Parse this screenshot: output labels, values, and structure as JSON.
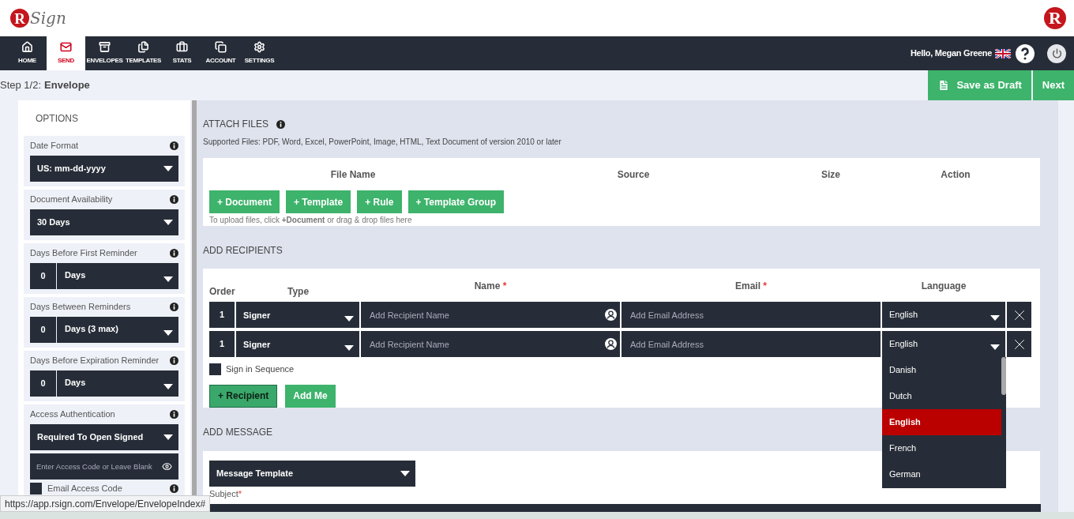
{
  "header": {
    "logo": {
      "mark": "R",
      "word": "Sign"
    },
    "corner_logo": "R"
  },
  "nav": {
    "tabs": [
      {
        "label": "HOME",
        "selected": false
      },
      {
        "label": "SEND",
        "selected": true
      },
      {
        "label": "ENVELOPES",
        "selected": false
      },
      {
        "label": "TEMPLATES",
        "selected": false
      },
      {
        "label": "STATS",
        "selected": false
      },
      {
        "label": "ACCOUNT",
        "selected": false
      },
      {
        "label": "SETTINGS",
        "selected": false
      }
    ],
    "greeting": "Hello, Megan Greene"
  },
  "step": {
    "label": "Step 1/2:",
    "title": "Envelope"
  },
  "actions": [
    {
      "label": "Save as Draft",
      "kind": "draft"
    },
    {
      "label": "Next",
      "kind": "plain"
    }
  ],
  "options": {
    "title": "OPTIONS",
    "fields": [
      {
        "label": "Date Format",
        "kind": "select",
        "value": "US: mm-dd-yyyy"
      },
      {
        "label": "Document Availability",
        "kind": "select",
        "value": "30 Days"
      },
      {
        "label": "Days Before First Reminder",
        "kind": "count",
        "count": "0",
        "value": "Days"
      },
      {
        "label": "Days Between Reminders",
        "kind": "count",
        "count": "0",
        "value": "Days (3 max)"
      },
      {
        "label": "Days Before Expiration Reminder",
        "kind": "count",
        "count": "0",
        "value": "Days"
      },
      {
        "label": "Access Authentication",
        "kind": "access",
        "value": "Required To Open Signed",
        "placeholder": "Enter Access Code or Leave Blank",
        "email_access_code": {
          "label": "Email Access Code",
          "checked": false
        }
      }
    ]
  },
  "attach": {
    "title": "ATTACH FILES",
    "note": "Supported Files: PDF, Word, Excel, PowerPoint, Image, HTML, Text Document of version 2010 or later",
    "columns": [
      "File Name",
      "Source",
      "Size",
      "Action"
    ],
    "buttons": [
      "+ Document",
      "+ Template",
      "+ Rule",
      "+ Template Group"
    ],
    "hint": "To upload files, click **+Document** or drag & drop files here"
  },
  "recipients": {
    "title": "ADD RECIPIENTS",
    "required_mark": "*",
    "columns": [
      {
        "label": "Order",
        "required": false
      },
      {
        "label": "Type",
        "required": false
      },
      {
        "label": "Name",
        "required": true
      },
      {
        "label": "Email",
        "required": true
      },
      {
        "label": "Language",
        "required": false
      }
    ],
    "rows": [
      {
        "order": "1",
        "type": "Signer",
        "name_placeholder": "Add Recipient Name",
        "email_placeholder": "Add Email Address",
        "language": "English",
        "open": false
      },
      {
        "order": "1",
        "type": "Signer",
        "name_placeholder": "Add Recipient Name",
        "email_placeholder": "Add Email Address",
        "language": "English",
        "open": true
      }
    ],
    "language_options": [
      {
        "label": "Danish",
        "selected": false
      },
      {
        "label": "Dutch",
        "selected": false
      },
      {
        "label": "English",
        "selected": true
      },
      {
        "label": "French",
        "selected": false
      },
      {
        "label": "German",
        "selected": false
      }
    ],
    "sign_in_sequence": {
      "label": "Sign in Sequence",
      "checked": false
    },
    "buttons": [
      {
        "label": "+ Recipient",
        "focused": true
      },
      {
        "label": "Add Me",
        "focused": false
      }
    ]
  },
  "message": {
    "title": "ADD MESSAGE",
    "template": "Message Template",
    "subject_label": "Subject",
    "subject_required": true,
    "required_mark": "*"
  },
  "status_url": "https://app.rsign.com/Envelope/EnvelopeIndex#"
}
